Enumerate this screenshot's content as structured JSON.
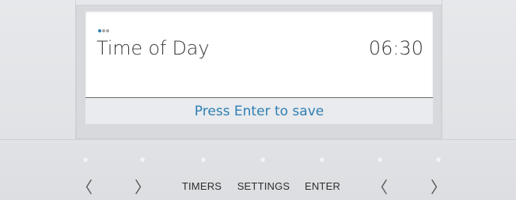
{
  "display": {
    "label": "Time of Day",
    "value": "06:30",
    "status": "Press Enter to save",
    "page_dots": {
      "total": 3,
      "active": 1
    }
  },
  "controls": {
    "left_prev": "〈",
    "left_next": "〉",
    "timers": "TIMERS",
    "settings": "SETTINGS",
    "enter": "ENTER",
    "right_prev": "〈",
    "right_next": "〉"
  },
  "colors": {
    "accent": "#2f7fb3",
    "panel": "#e1e3e6",
    "screen": "#ffffff",
    "status_bar": "#e9ebee"
  }
}
